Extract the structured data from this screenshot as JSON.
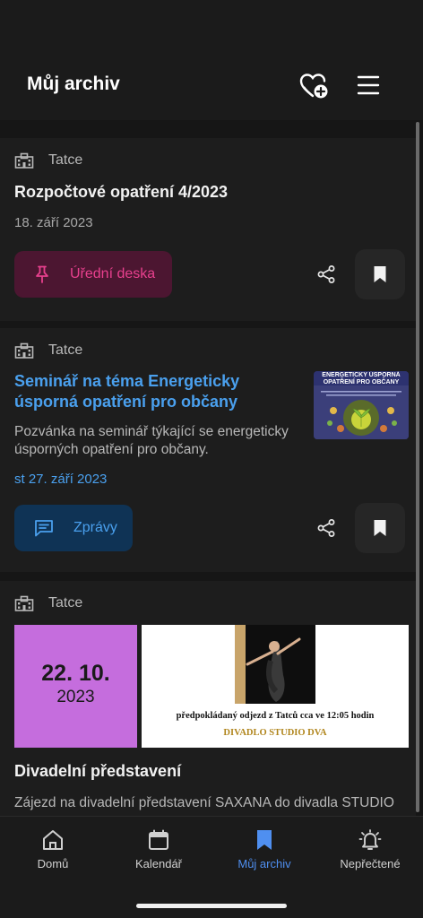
{
  "header": {
    "title": "Můj archiv",
    "favorite_icon": "heart-plus-icon",
    "menu_icon": "hamburger-menu-icon"
  },
  "cards": [
    {
      "source": "Tatce",
      "title": "Rozpočtové opatření 4/2023",
      "date": "18. září 2023",
      "category": "Úřední deska",
      "category_icon": "pin-icon",
      "category_color": "#e8408e"
    },
    {
      "source": "Tatce",
      "title": "Seminář na téma Energeticky úsporná opatření pro občany",
      "description": "Pozvánka na seminář týkající se energeticky úsporných opatření pro občany.",
      "date": "st 27. září 2023",
      "category": "Zprávy",
      "category_icon": "message-icon",
      "category_color": "#4aa0ee",
      "thumbnail": {
        "line1": "ENERGETICKY ÚSPORNÁ",
        "line2": "OPATŘENÍ PRO OBČANY"
      }
    },
    {
      "source": "Tatce",
      "date_tile_day": "22. 10.",
      "date_tile_year": "2023",
      "poster_text": "předpokládaný odjezd z Tatců cca ve 12:05 hodin",
      "poster_footer": "DIVADLO STUDIO DVA",
      "title": "Divadelní představení",
      "description": "Zájezd na divadelní představení SAXANA do divadla STUDIO"
    }
  ],
  "bottom_nav": [
    {
      "label": "Domů",
      "icon": "home-icon",
      "active": false
    },
    {
      "label": "Kalendář",
      "icon": "calendar-icon",
      "active": false
    },
    {
      "label": "Můj archiv",
      "icon": "bookmark-icon",
      "active": true
    },
    {
      "label": "Nepřečtené",
      "icon": "bell-icon",
      "active": false
    }
  ],
  "colors": {
    "accent_blue": "#4aa0ee",
    "accent_pink": "#e8408e",
    "nav_active": "#4f8ff0",
    "date_tile": "#c56ddd"
  }
}
